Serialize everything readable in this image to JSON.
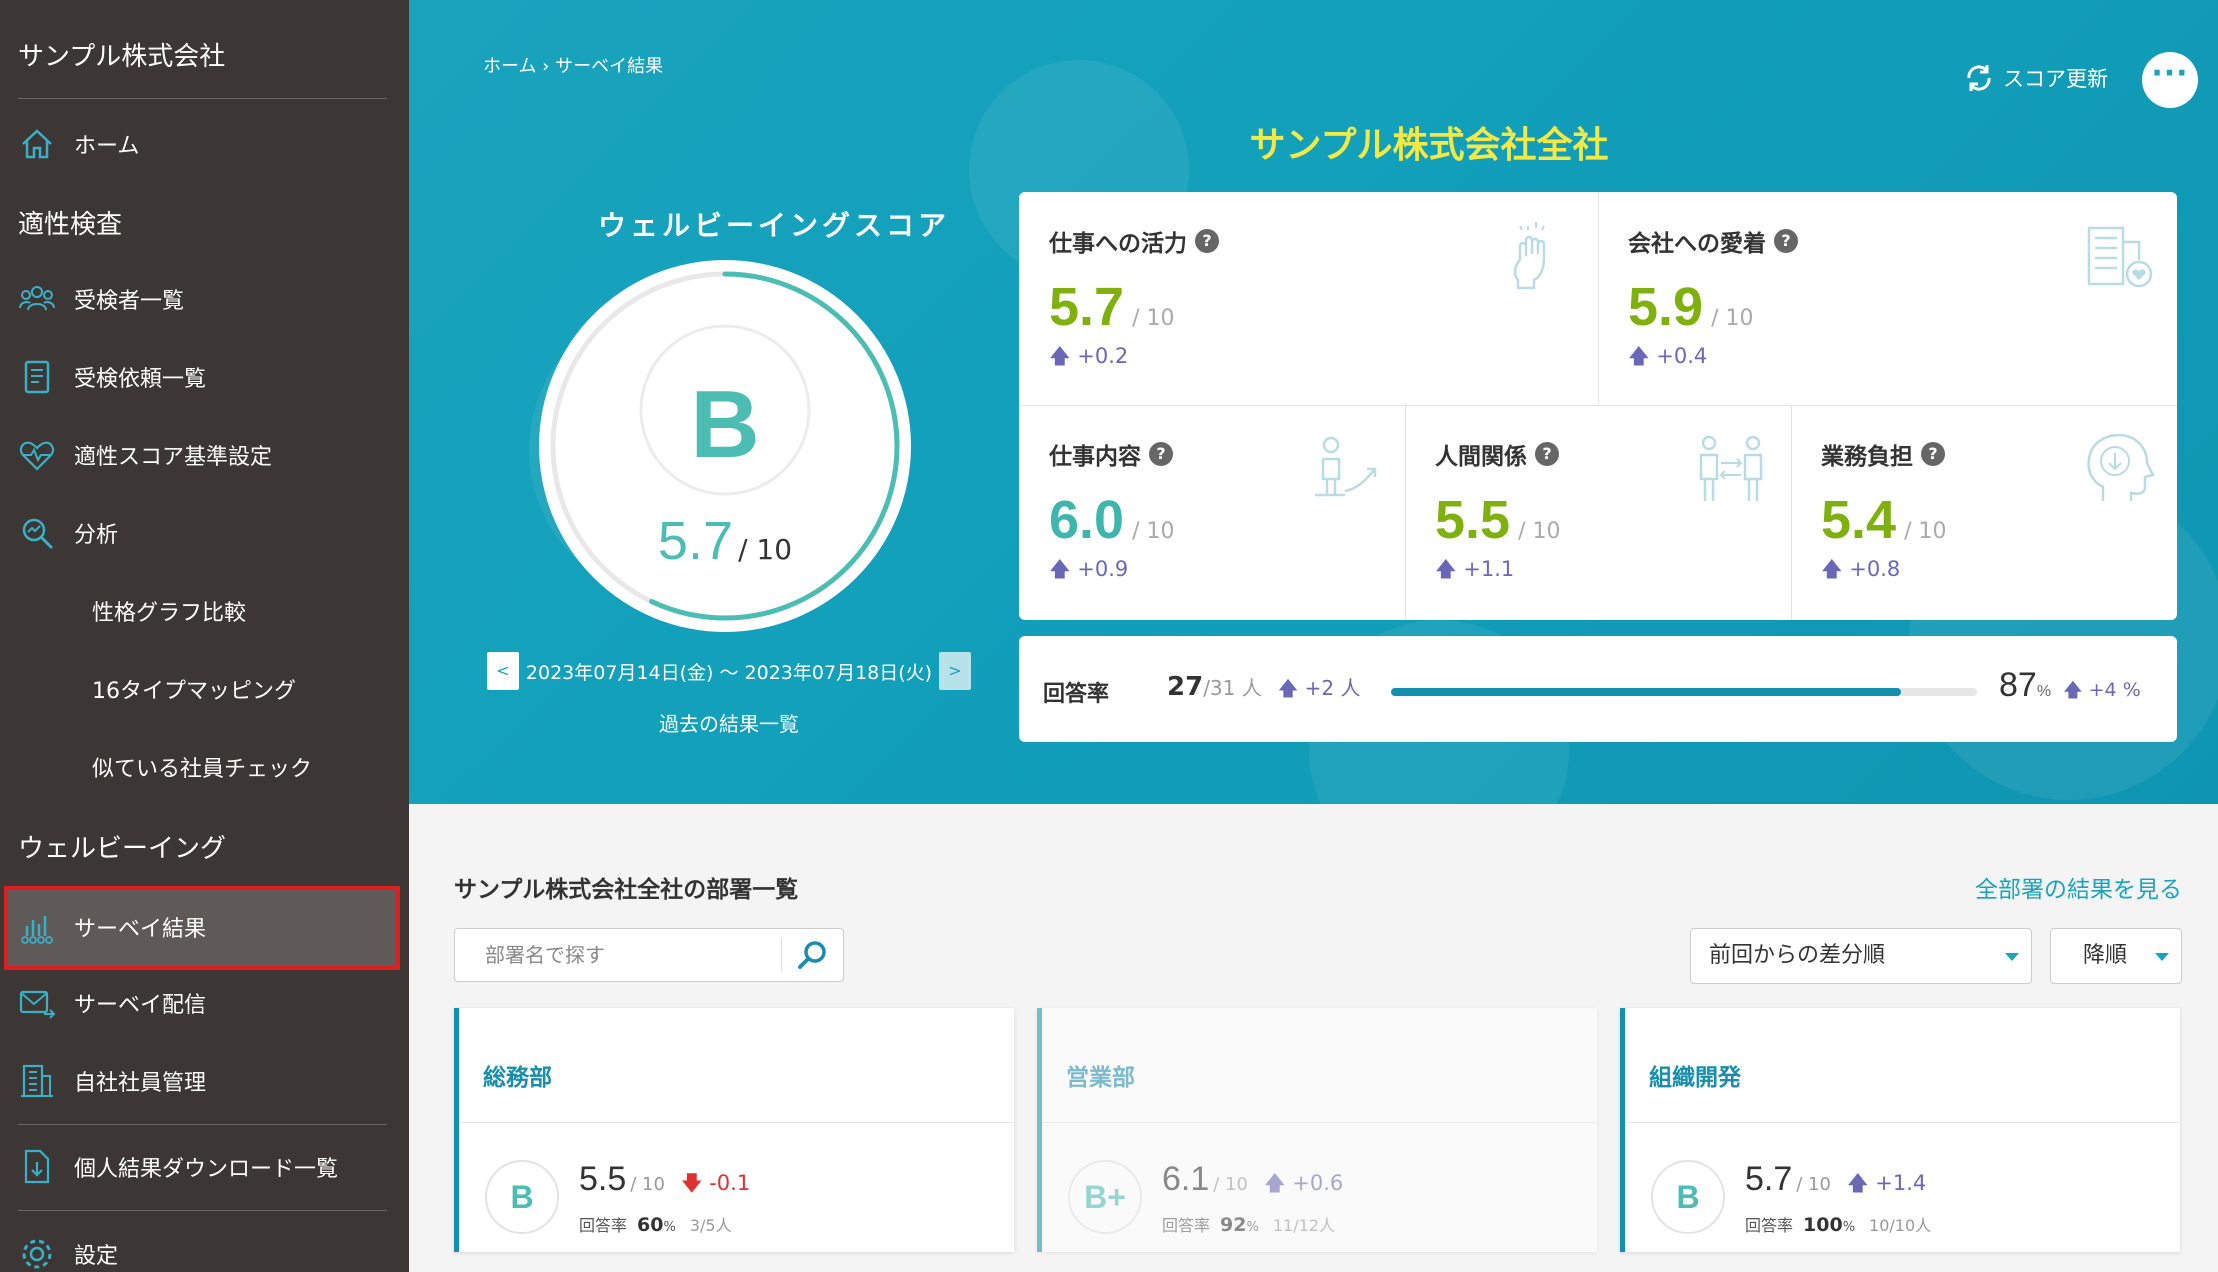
{
  "sidebar": {
    "company": "サンプル株式会社",
    "home": "ホーム",
    "section_aptitude": "適性検査",
    "examinees": "受検者一覧",
    "requests": "受検依頼一覧",
    "score_settings": "適性スコア基準設定",
    "analysis": "分析",
    "graph_compare": "性格グラフ比較",
    "type_mapping": "16タイプマッピング",
    "similar_check": "似ている社員チェック",
    "section_wellbeing": "ウェルビーイング",
    "survey_results": "サーベイ結果",
    "survey_delivery": "サーベイ配信",
    "employee_mgmt": "自社社員管理",
    "downloads": "個人結果ダウンロード一覧",
    "settings": "設定"
  },
  "header": {
    "breadcrumb": "ホーム › サーベイ結果",
    "refresh": "スコア更新",
    "more": "···",
    "org_title": "サンプル株式会社全社"
  },
  "wellbeing": {
    "title": "ウェルビーイングスコア",
    "grade": "B",
    "score": "5.7",
    "max": "/ 10",
    "score_ratio": 0.57,
    "date_range": "2023年07月14日(金) ～ 2023年07月18日(火)",
    "prev": "<",
    "next": ">",
    "past_link": "過去の結果一覧"
  },
  "metrics": [
    {
      "name": "仕事への活力",
      "value": "5.7",
      "max": "/ 10",
      "delta": "+0.2",
      "icon": "fist-icon"
    },
    {
      "name": "会社への愛着",
      "value": "5.9",
      "max": "/ 10",
      "delta": "+0.4",
      "icon": "building-heart-icon"
    },
    {
      "name": "仕事内容",
      "value": "6.0",
      "max": "/ 10",
      "delta": "+0.9",
      "icon": "person-growth-icon"
    },
    {
      "name": "人間関係",
      "value": "5.5",
      "max": "/ 10",
      "delta": "+1.1",
      "icon": "people-exchange-icon"
    },
    {
      "name": "業務負担",
      "value": "5.4",
      "max": "/ 10",
      "delta": "+0.8",
      "icon": "head-down-icon"
    }
  ],
  "response": {
    "label": "回答率",
    "count": "27",
    "total": "/31 人",
    "count_delta": "+2 人",
    "percent": "87",
    "percent_unit": "%",
    "percent_delta": "+4 %",
    "ratio": 0.87
  },
  "departments": {
    "title": "サンプル株式会社全社の部署一覧",
    "all_link": "全部署の結果を見る",
    "search_placeholder": "部署名で探す",
    "sort_select": "前回からの差分順",
    "order_select": "降順",
    "rate_label": "回答率",
    "items": [
      {
        "name": "総務部",
        "grade": "B",
        "score": "5.5",
        "max": "/ 10",
        "delta": "-0.1",
        "rate": "60",
        "pct": "%",
        "count": "3/5人"
      },
      {
        "name": "営業部",
        "grade": "B+",
        "score": "6.1",
        "max": "/ 10",
        "delta": "+0.6",
        "rate": "92",
        "pct": "%",
        "count": "11/12人"
      },
      {
        "name": "組織開発",
        "grade": "B",
        "score": "5.7",
        "max": "/ 10",
        "delta": "+1.4",
        "rate": "100",
        "pct": "%",
        "count": "10/10人"
      }
    ]
  },
  "colors": {
    "hero": "#12a0bb",
    "accent_yellow": "#f3e945",
    "score_green": "#7fb00e",
    "score_teal": "#3eb6ad",
    "delta_up": "#6a68b6",
    "delta_down": "#e03131",
    "sidebar_bg": "#3c3735",
    "active_border": "#e11d1d"
  }
}
